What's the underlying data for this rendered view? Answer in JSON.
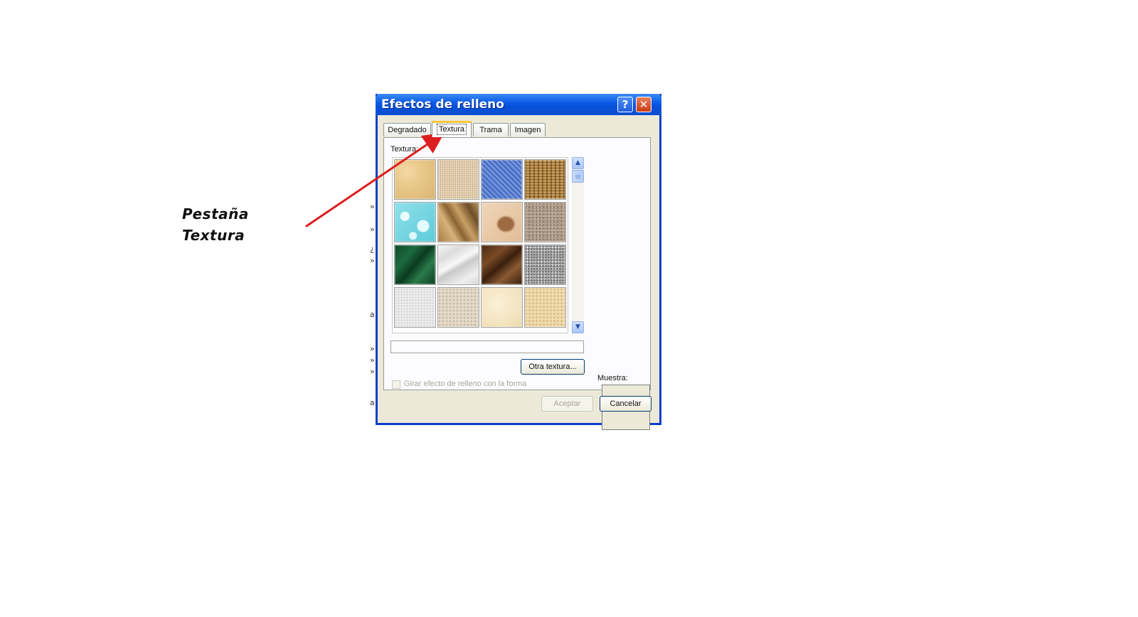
{
  "annotation": {
    "line1": "Pestaña",
    "line2": "Textura",
    "arrow_color": "#dd1e1e"
  },
  "dialog": {
    "title": "Efectos de relleno",
    "help_label": "?",
    "close_label": "✕",
    "titlebar_color": "#0b55e0",
    "tabs": [
      {
        "label": "Degradado",
        "active": false
      },
      {
        "label": "Textura",
        "active": true
      },
      {
        "label": "Trama",
        "active": false
      },
      {
        "label": "Imagen",
        "active": false
      }
    ],
    "texture_label": "Textura:",
    "textures": [
      "papyrus",
      "canvas",
      "denim",
      "woven-mat",
      "water-droplets",
      "paper-bag",
      "fish-fossil",
      "sand",
      "green-marble",
      "white-marble",
      "brown-marble",
      "granite",
      "newsprint",
      "recycled-paper",
      "parchment",
      "stationery"
    ],
    "path_value": "",
    "other_texture_button": "Otra textura...",
    "rotate_checkbox_label": "Girar efecto de relleno con la forma",
    "rotate_checked": false,
    "sample_label": "Muestra:",
    "ok_button": "Aceptar",
    "cancel_button": "Cancelar"
  }
}
